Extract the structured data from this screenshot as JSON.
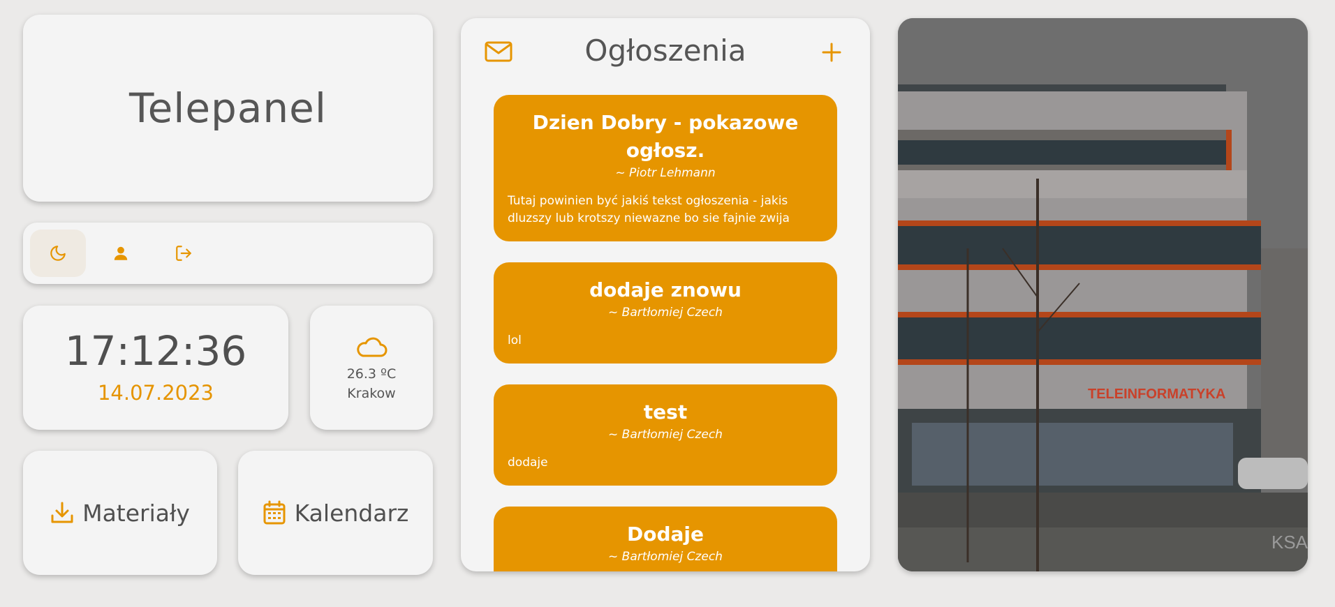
{
  "app": {
    "title": "Telepanel"
  },
  "toolbar": {
    "items": [
      {
        "name": "theme-toggle",
        "icon": "moon-icon",
        "active": true
      },
      {
        "name": "profile",
        "icon": "user-icon",
        "active": false
      },
      {
        "name": "logout",
        "icon": "logout-icon",
        "active": false
      }
    ]
  },
  "clock": {
    "time": "17:12:36",
    "date": "14.07.2023"
  },
  "weather": {
    "icon": "cloud-icon",
    "temperature": "26.3 ºC",
    "city": "Krakow"
  },
  "buttons": {
    "materials": {
      "label": "Materiały",
      "icon": "download-icon"
    },
    "calendar": {
      "label": "Kalendarz",
      "icon": "calendar-icon"
    }
  },
  "announcements": {
    "title": "Ogłoszenia",
    "header_icons": [
      "mail-icon",
      "plus-icon"
    ],
    "items": [
      {
        "title": "Dzien Dobry - pokazowe ogłosz.",
        "author": "~ Piotr Lehmann",
        "body": "Tutaj powinien być jakiś tekst ogłoszenia - jakis dluzszy lub krotszy niewazne bo sie fajnie zwija"
      },
      {
        "title": "dodaje znowu",
        "author": "~ Bartłomiej Czech",
        "body": "lol"
      },
      {
        "title": "test",
        "author": "~ Bartłomiej Czech",
        "body": "dodaje"
      },
      {
        "title": "Dodaje",
        "author": "~ Bartłomiej Czech",
        "body": ""
      }
    ]
  },
  "photo": {
    "sign_text": "TELEINFORMATYKA",
    "corner_text": "KSA"
  },
  "colors": {
    "accent": "#e69500",
    "background": "#ebeae9",
    "card": "#f4f4f4",
    "text": "#555555"
  }
}
